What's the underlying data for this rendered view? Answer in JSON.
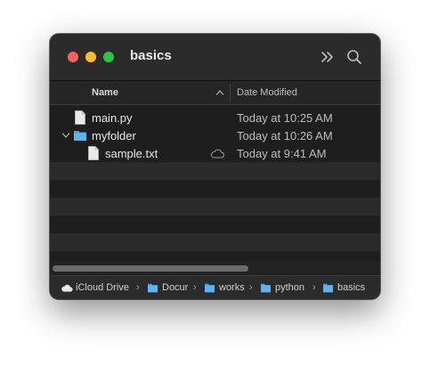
{
  "window": {
    "title": "basics",
    "traffic_colors": {
      "close": "#fe5f57",
      "minimize": "#febc2e",
      "maximize": "#28c840"
    }
  },
  "toolbar": {
    "icons": [
      "chevron-double-right-icon",
      "search-icon"
    ]
  },
  "columns": {
    "name": "Name",
    "date_modified": "Date Modified",
    "sort_icon": "chevron-up-icon"
  },
  "files": [
    {
      "name": "main.py",
      "date": "Today at 10:25 AM",
      "icon": "document-icon"
    },
    {
      "name": "myfolder",
      "date": "Today at 10:26 AM",
      "icon": "folder-icon",
      "expanded": true
    },
    {
      "name": "sample.txt",
      "date": "Today at 9:41 AM",
      "icon": "document-icon",
      "status_icon": "cloud-icon"
    }
  ],
  "path_bar": {
    "items": [
      {
        "label": "iCloud Drive",
        "icon": "cloud-icon"
      },
      {
        "label": "Docur",
        "icon": "folder-icon"
      },
      {
        "label": "works",
        "icon": "folder-icon"
      },
      {
        "label": "python",
        "icon": "folder-icon"
      },
      {
        "label": "basics",
        "icon": "folder-icon"
      }
    ],
    "separator": "›"
  },
  "colors": {
    "folder": "#5cb3f2",
    "window_bg": "#1e1e1e",
    "text": "#e6e6e6"
  }
}
